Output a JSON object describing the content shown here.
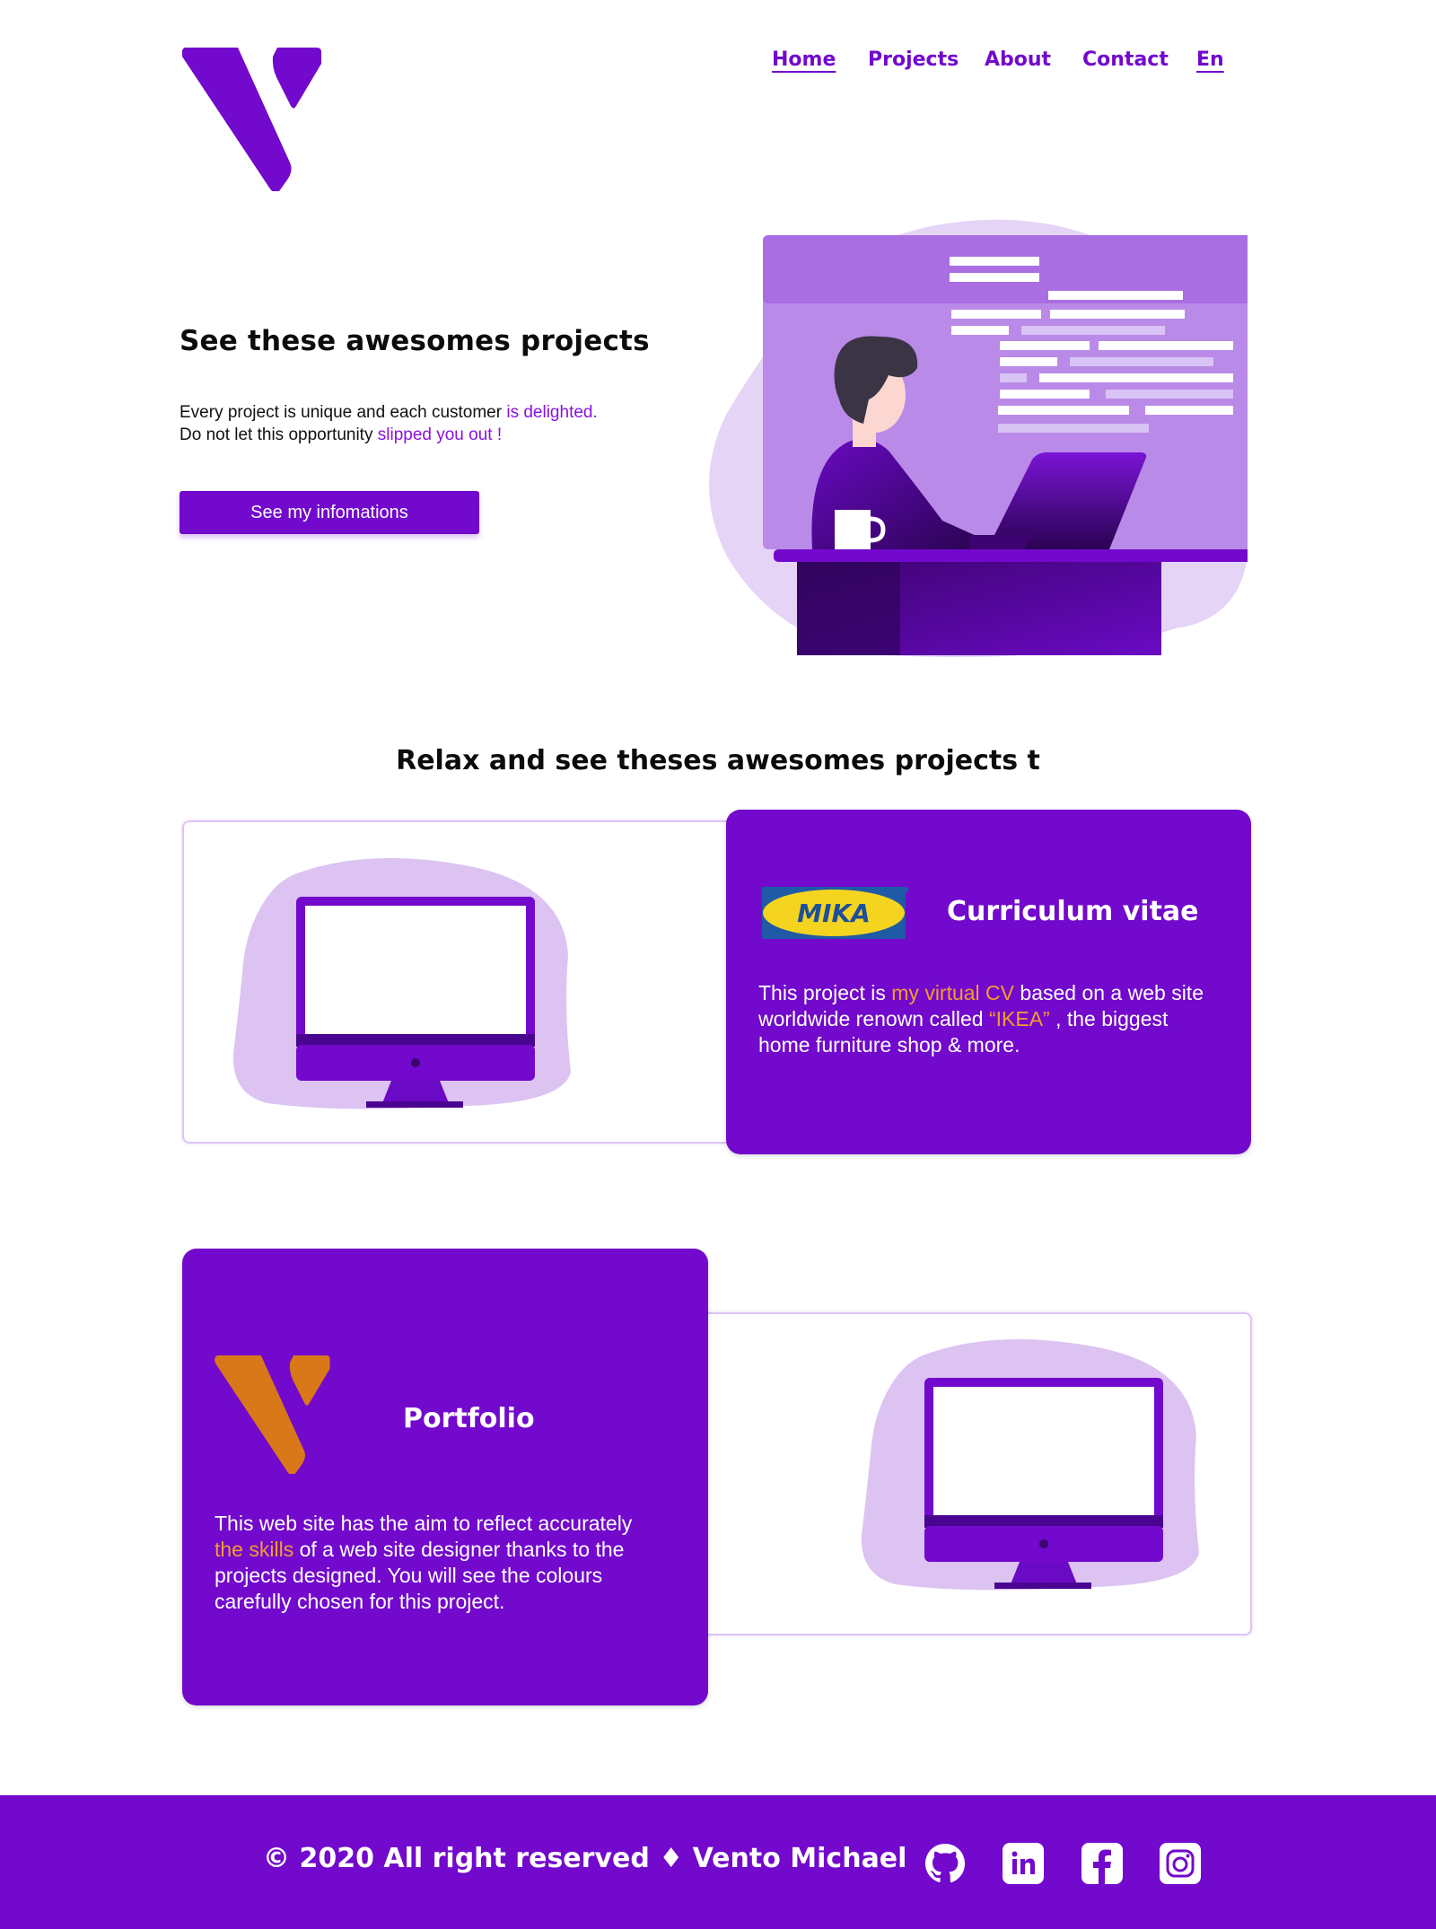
{
  "nav": {
    "items": [
      {
        "label": "Home",
        "active": true
      },
      {
        "label": "Projects",
        "active": false
      },
      {
        "label": "About",
        "active": false
      },
      {
        "label": "Contact",
        "active": false
      },
      {
        "label": "En",
        "active": true
      }
    ]
  },
  "hero": {
    "title": "See these awesomes projects",
    "line1_a": "Every project is unique and each customer ",
    "line1_b": "is delighted.",
    "line2_a": "Do not let this opportunity ",
    "line2_b": "slipped you out !",
    "button_label": "See my infomations"
  },
  "section": {
    "title": "Relax and see theses awesomes projects t"
  },
  "projects": [
    {
      "logo_text": "MIKA",
      "title": "Curriculum vitae",
      "text_a": "This project is ",
      "text_b": "my virtual CV",
      "text_c": " based on a web site worldwide renown called ",
      "text_d": "“IKEA”",
      "text_e": " , the biggest home furniture shop & more."
    },
    {
      "title": "Portfolio",
      "text_a": "This web site has the aim to reflect accurately ",
      "text_b": "the skills",
      "text_c": " of a web site designer thanks to the projects designed. You will see the colours carefully chosen for this project."
    }
  ],
  "footer": {
    "copyright": "© 2020 All right reserved ♦ Vento Michael",
    "social_icons": [
      "github-icon",
      "linkedin-icon",
      "facebook-icon",
      "instagram-icon"
    ]
  },
  "colors": {
    "brand_purple": "#7209cc",
    "light_purple": "#e5d4f6",
    "accent_orange": "#f39c2e",
    "logo_orange": "#d97818"
  }
}
